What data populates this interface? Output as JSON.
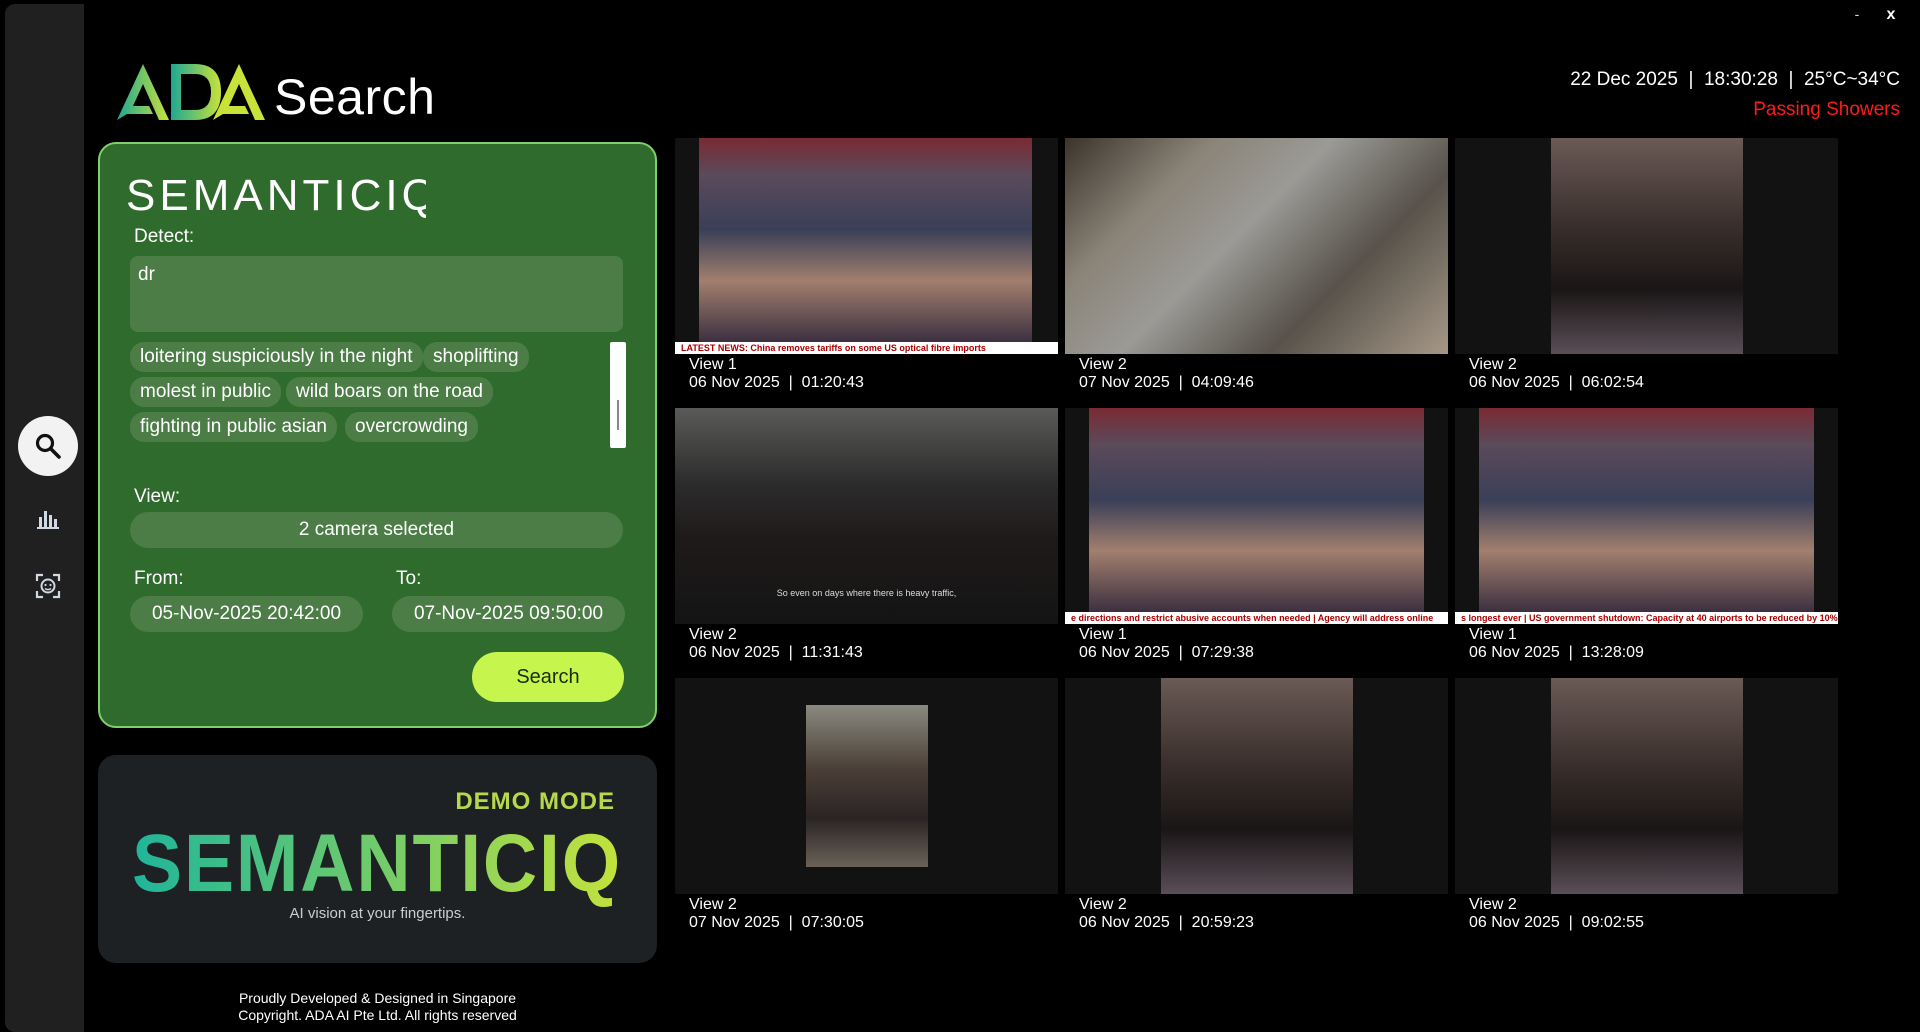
{
  "window": {
    "minimize": "-",
    "close": "x"
  },
  "header": {
    "app_title": "Search",
    "datetime": "22 Dec 2025  |  18:30:28  |  25°C~34°C",
    "weather": "Passing Showers"
  },
  "panel": {
    "brand": "SEMANTICIQ",
    "detect_label": "Detect:",
    "detect_value": "dr",
    "suggestions": [
      "loitering suspiciously in the night",
      "shoplifting",
      "molest in public",
      "wild boars on the road",
      "fighting in public asian",
      "overcrowding"
    ],
    "view_label": "View:",
    "view_value": "2 camera selected",
    "from_label": "From:",
    "to_label": "To:",
    "from_value": "05-Nov-2025 20:42:00",
    "to_value": "07-Nov-2025 09:50:00",
    "search_button": "Search"
  },
  "demo": {
    "mode": "DEMO MODE",
    "brand": "SEMANTICIQ",
    "tagline": "AI vision at your fingertips."
  },
  "footer": {
    "line1": "Proudly Developed & Designed in Singapore",
    "line2": "Copyright. ADA AI Pte Ltd. All rights reserved"
  },
  "results": [
    {
      "view": "View 1",
      "time": "06 Nov 2025  |  01:20:43",
      "ticker": "LATEST NEWS:  China removes tariffs on some US optical fibre imports"
    },
    {
      "view": "View 2",
      "time": "07 Nov 2025  |  04:09:46"
    },
    {
      "view": "View 2",
      "time": "06 Nov 2025  |  06:02:54"
    },
    {
      "view": "View 2",
      "time": "06 Nov 2025  |  11:31:43",
      "subtitle": "So even on days where there is heavy traffic,"
    },
    {
      "view": "View 1",
      "time": "06 Nov 2025  |  07:29:38",
      "ticker": "e directions and restrict abusive accounts when needed  |  Agency will address online fight"
    },
    {
      "view": "View 1",
      "time": "06 Nov 2025  |  13:28:09",
      "ticker": "s longest ever  |  US government shutdown: Capacity at 40 airports to be reduced by 10%"
    },
    {
      "view": "View 2",
      "time": "07 Nov 2025  |  07:30:05"
    },
    {
      "view": "View 2",
      "time": "06 Nov 2025  |  20:59:23"
    },
    {
      "view": "View 2",
      "time": "06 Nov 2025  |  09:02:55"
    }
  ],
  "icons": {
    "rail": [
      "search-icon",
      "bar-chart-icon",
      "face-scan-icon"
    ]
  },
  "colors": {
    "panel_bg": "#2f6b2d",
    "panel_border": "#7fd06a",
    "chip_bg": "#4c7d47",
    "accent_button": "#c6f54e",
    "alert": "#ff1a1a"
  }
}
